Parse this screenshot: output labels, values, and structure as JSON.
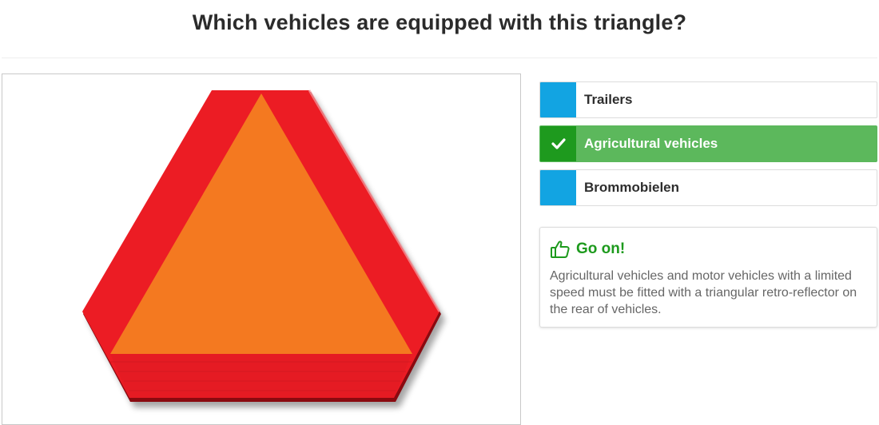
{
  "question": {
    "title": "Which vehicles are equipped with this triangle?"
  },
  "image": {
    "icon": "slow-moving-vehicle-triangle",
    "colors": {
      "outer": "#ec1c24",
      "inner": "#f47920",
      "shadow": "#8a0a10"
    }
  },
  "answers": [
    {
      "label": "Trailers",
      "state": "unselected"
    },
    {
      "label": "Agricultural vehicles",
      "state": "correct",
      "icon": "check-icon"
    },
    {
      "label": "Brommobielen",
      "state": "unselected"
    }
  ],
  "feedback": {
    "icon": "thumbs-up-icon",
    "title": "Go on!",
    "text": "Agricultural vehicles and motor vehicles with a limited speed must be fitted with a triangular retro-reflector on the rear of vehicles."
  },
  "colors": {
    "accent": "#12a4e2",
    "correct_bg": "#5cb85c",
    "correct_indicator": "#1e9a1e",
    "feedback_title": "#1d9a1d"
  }
}
